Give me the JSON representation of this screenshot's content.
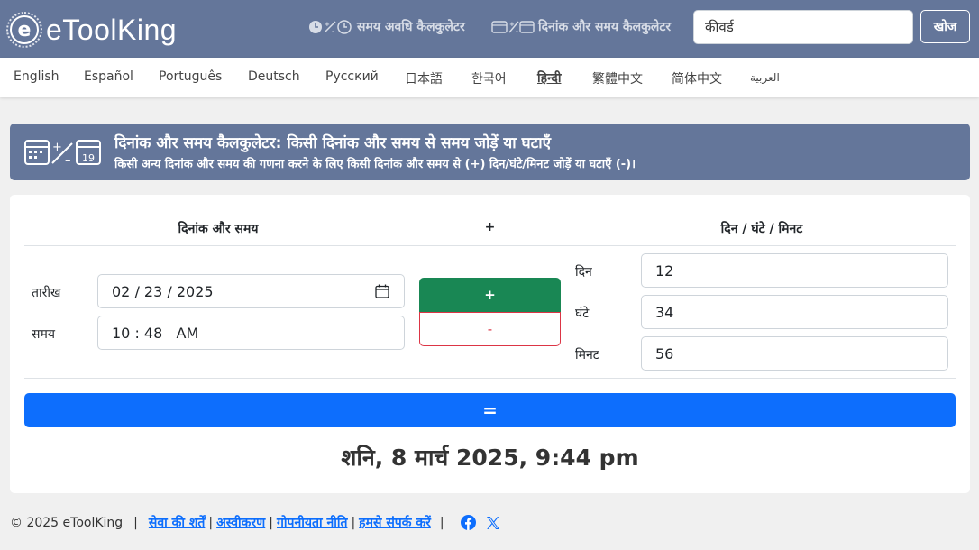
{
  "header": {
    "logo_text": "eToolKing",
    "nav": [
      {
        "label": "समय अवधि कैलकुलेटर"
      },
      {
        "label": "दिनांक और समय कैलकुलेटर"
      }
    ],
    "search_placeholder": "कीवर्ड",
    "search_button": "खोज"
  },
  "languages": [
    "English",
    "Español",
    "Português",
    "Deutsch",
    "Русский",
    "日本語",
    "한국어",
    "हिन्दी",
    "繁體中文",
    "简体中文",
    "العربية"
  ],
  "active_language": "हिन्दी",
  "banner": {
    "title": "दिनांक और समय कैलकुलेटर: किसी दिनांक और समय से समय जोड़ें या घटाएँ",
    "subtitle": "किसी अन्य दिनांक और समय की गणना करने के लिए किसी दिनांक और समय से (+) दिन/घंटे/मिनट जोड़ें या घटाएँ (-)।"
  },
  "calculator": {
    "col_datetime": "दिनांक और समय",
    "col_operator": "+",
    "col_duration": "दिन / घंटे / मिनट",
    "date_label": "तारीख",
    "date_value": "02 / 23 / 2025",
    "time_label": "समय",
    "time_value": "10 : 48   AM",
    "plus_label": "+",
    "minus_label": "-",
    "days_label": "दिन",
    "days_value": "12",
    "hours_label": "घंटे",
    "hours_value": "34",
    "minutes_label": "मिनट",
    "minutes_value": "56",
    "equals_label": "=",
    "result": "शनि, 8 मार्च 2025, 9:44 pm"
  },
  "footer": {
    "copyright": "© 2025 eToolKing",
    "links": [
      "सेवा की शर्तें",
      "अस्वीकरण",
      "गोपनीयता नीति",
      "हमसे संपर्क करें"
    ]
  },
  "colors": {
    "header_bg": "#64769a",
    "plus_green": "#198754",
    "minus_red": "#dc3545",
    "equals_blue": "#0d6efd"
  }
}
